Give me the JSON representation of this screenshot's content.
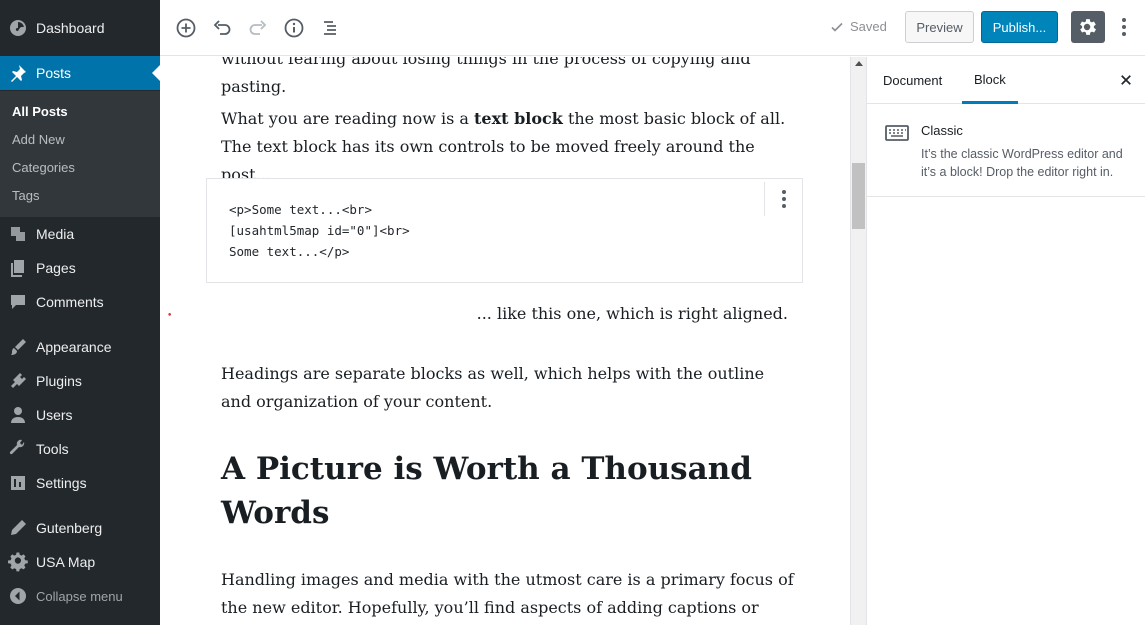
{
  "admin_menu": {
    "items": [
      {
        "label": "Dashboard",
        "icon": "dashboard-icon"
      },
      {
        "label": "Posts",
        "icon": "pin-icon"
      },
      {
        "label": "Media",
        "icon": "media-icon"
      },
      {
        "label": "Pages",
        "icon": "pages-icon"
      },
      {
        "label": "Comments",
        "icon": "comments-icon"
      },
      {
        "label": "Appearance",
        "icon": "brush-icon"
      },
      {
        "label": "Plugins",
        "icon": "plug-icon"
      },
      {
        "label": "Users",
        "icon": "user-icon"
      },
      {
        "label": "Tools",
        "icon": "wrench-icon"
      },
      {
        "label": "Settings",
        "icon": "settings-sliders-icon"
      },
      {
        "label": "Gutenberg",
        "icon": "pen-icon"
      },
      {
        "label": "USA Map",
        "icon": "gear-icon"
      },
      {
        "label": "Collapse menu",
        "icon": "collapse-arrow-icon"
      }
    ],
    "submenu": [
      "All Posts",
      "Add New",
      "Categories",
      "Tags"
    ]
  },
  "toolbar": {
    "saved_label": "Saved",
    "preview_label": "Preview",
    "publish_label": "Publish...",
    "accent_color": "#0085ba"
  },
  "editor": {
    "paragraph_top": "without fearing about losing things in the process of copying and pasting.",
    "paragraph_text_block_pre": "What you are reading now is a ",
    "paragraph_text_block_bold": "text block",
    "paragraph_text_block_post": " the most basic block of all. The text block has its own controls to be moved freely around the post...",
    "classic_code": "<p>Some text...<br>\n[usahtml5map id=\"0\"]<br>\nSome text...</p>",
    "right_aligned": "... like this one, which is right aligned.",
    "headings_paragraph": "Headings are separate blocks as well, which helps with the outline and organization of your content.",
    "heading": "A Picture is Worth a Thousand Words",
    "images_paragraph": "Handling images and media with the utmost care is a primary focus of the new editor. Hopefully, you’ll find aspects of adding captions or going full-"
  },
  "settings_panel": {
    "tab_document": "Document",
    "tab_block": "Block",
    "block_title": "Classic",
    "block_description": "It’s the classic WordPress editor and it’s a block! Drop the editor right in."
  }
}
